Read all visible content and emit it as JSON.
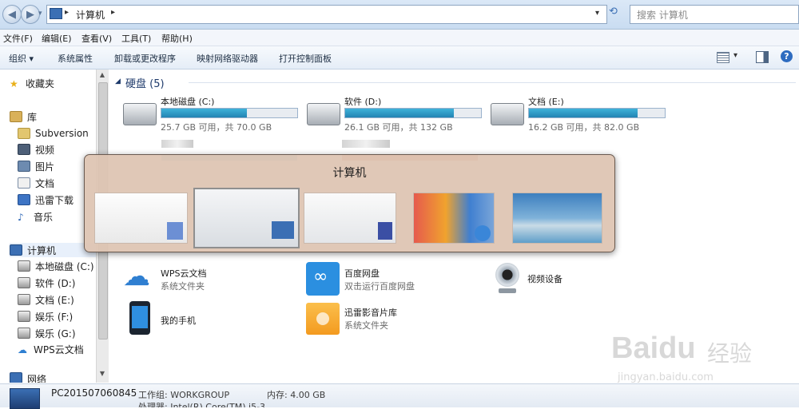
{
  "address": {
    "path_label": "计算机",
    "search_placeholder": "搜索 计算机"
  },
  "menu": [
    "文件(F)",
    "编辑(E)",
    "查看(V)",
    "工具(T)",
    "帮助(H)"
  ],
  "toolbar": {
    "organize": "组织",
    "items": [
      "系统属性",
      "卸载或更改程序",
      "映射网络驱动器",
      "打开控制面板"
    ]
  },
  "nav": {
    "favorites": "收藏夹",
    "library": "库",
    "library_items": [
      "Subversion",
      "视频",
      "图片",
      "文档",
      "迅雷下载",
      "音乐"
    ],
    "computer": "计算机",
    "computer_items": [
      "本地磁盘 (C:)",
      "软件 (D:)",
      "文档 (E:)",
      "娱乐 (F:)",
      "娱乐 (G:)",
      "WPS云文档"
    ],
    "network": "网络"
  },
  "content": {
    "hard_disks_header": "硬盘 (5)",
    "drives": [
      {
        "name": "本地磁盘 (C:)",
        "free_text": "25.7 GB 可用，共 70.0 GB",
        "used_fraction": 0.63
      },
      {
        "name": "软件 (D:)",
        "free_text": "26.1 GB 可用，共 132 GB",
        "used_fraction": 0.8
      },
      {
        "name": "文档 (E:)",
        "free_text": "16.2 GB 可用，共 82.0 GB",
        "used_fraction": 0.8
      }
    ],
    "others": [
      {
        "title": "WPS云文档",
        "sub": "系统文件夹",
        "icon": "cloud-icon"
      },
      {
        "title": "百度网盘",
        "sub": "双击运行百度网盘",
        "icon": "baidu-netdisk-icon"
      },
      {
        "title": "视频设备",
        "sub": "",
        "icon": "webcam-icon"
      },
      {
        "title": "我的手机",
        "sub": "",
        "icon": "phone-icon"
      },
      {
        "title": "迅雷影音片库",
        "sub": "系统文件夹",
        "icon": "xunlei-folder-icon"
      }
    ]
  },
  "switcher": {
    "title": "计算机"
  },
  "status": {
    "pc_name": "PC201507060845",
    "workgroup": "工作组: WORKGROUP",
    "memory": "内存: 4.00 GB",
    "processor": "处理器: Intel(R) Core(TM) i5-3"
  },
  "watermark": {
    "brand": "Baidu",
    "brand_cn": "经验",
    "url": "jingyan.baidu.com"
  },
  "colors": {
    "bar_fill": "#2ba0cd",
    "switcher_bg": "#dec4b2",
    "group_header": "#1e3a6b"
  }
}
